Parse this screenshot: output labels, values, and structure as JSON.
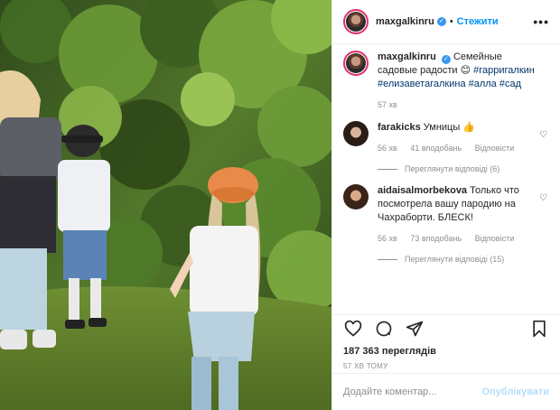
{
  "header": {
    "username": "maxgalkinru",
    "dot": "•",
    "follow_label": "Стежити",
    "more_label": "•••"
  },
  "caption": {
    "username": "maxgalkinru",
    "text": "Семейные садовые радости 😊",
    "hashtags": "#гарригалкин #елизаветагалкина #алла #сад",
    "time": "57 хв"
  },
  "comments": [
    {
      "username": "farakicks",
      "text": "Умницы 👍",
      "time": "56 хв",
      "likes": "41 вподобань",
      "reply": "Відповісти",
      "view_replies": "Переглянути відповіді (6)"
    },
    {
      "username": "aidaisalmorbekova",
      "text": "Только что посмотрела вашу пародию на Чахраборти. БЛЕСК!",
      "time": "56 хв",
      "likes": "73 вподобань",
      "reply": "Відповісти",
      "view_replies": "Переглянути відповіді (15)"
    }
  ],
  "stats": {
    "views": "187 363 переглядів",
    "posted": "57 ХВ ТОМУ"
  },
  "add_comment": {
    "placeholder": "Додайте коментар...",
    "publish_label": "Опублікувати"
  },
  "icons": {
    "like": "heart-icon",
    "comment": "comment-icon",
    "share": "share-icon",
    "save": "bookmark-icon"
  },
  "colors": {
    "accent": "#0095f6",
    "publish_disabled": "#b2dffc",
    "meta": "#8e8e8e"
  }
}
